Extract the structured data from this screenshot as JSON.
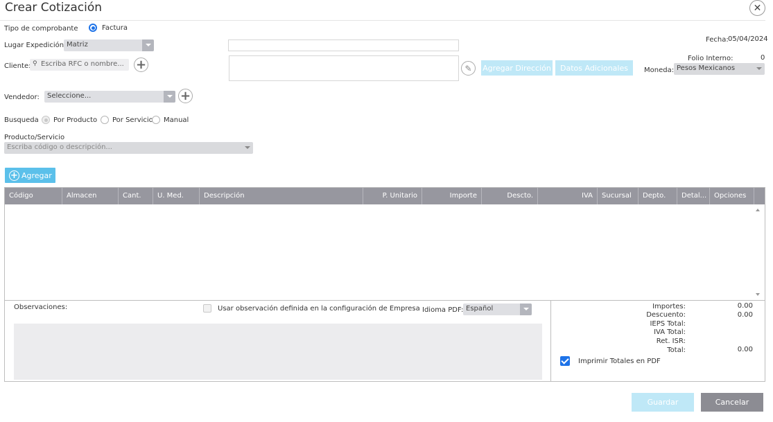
{
  "dialog": {
    "title": "Crear Cotización"
  },
  "tipo": {
    "label": "Tipo de comprobante",
    "option": "Factura"
  },
  "lugar": {
    "label": "Lugar Expedición",
    "value": "Matriz"
  },
  "fecha": {
    "label": "Fecha:",
    "value": "05/04/2024"
  },
  "cliente": {
    "label": "Cliente:",
    "placeholder": "Escriba RFC o nombre..."
  },
  "folio": {
    "label": "Folio Interno:",
    "value": "0"
  },
  "buttons": {
    "agregar_direccion": "Agregar Dirección",
    "datos_adicionales": "Datos Adicionales",
    "agregar": "Agregar",
    "guardar": "Guardar",
    "cancelar": "Cancelar"
  },
  "moneda": {
    "label": "Moneda:",
    "value": "Pesos Mexicanos"
  },
  "vendedor": {
    "label": "Vendedor:",
    "value": "Seleccione..."
  },
  "busqueda": {
    "label": "Busqueda",
    "options": [
      "Por Producto",
      "Por Servicio",
      "Manual"
    ]
  },
  "producto": {
    "label": "Producto/Servicio",
    "placeholder": "Escriba código o descripción..."
  },
  "table": {
    "columns": [
      "Código",
      "Almacen",
      "Cant.",
      "U. Med.",
      "Descripción",
      "P. Unitario",
      "Importe",
      "Descto.",
      "IVA",
      "Sucursal",
      "Depto.",
      "Detal...",
      "Opciones"
    ]
  },
  "observaciones": {
    "label": "Observaciones:",
    "checkbox_label": "Usar observación definida en la configuración de Empresa",
    "idioma_label": "Idioma PDF:",
    "idioma_value": "Español"
  },
  "totals": {
    "importes_label": "Importes:",
    "importes_value": "0.00",
    "descuento_label": "Descuento:",
    "descuento_value": "0.00",
    "ieps_label": "IEPS Total:",
    "iva_label": "IVA Total:",
    "ret_isr_label": "Ret. ISR:",
    "total_label": "Total:",
    "total_value": "0.00",
    "imprimir_label": "Imprimir Totales en PDF"
  },
  "colors": {
    "header_bg": "#97979f",
    "button_blue": "#5bc0ea",
    "button_disabled": "#bfe8f7",
    "button_gray": "#8c8c93",
    "radio_selected": "#1e73e8"
  }
}
